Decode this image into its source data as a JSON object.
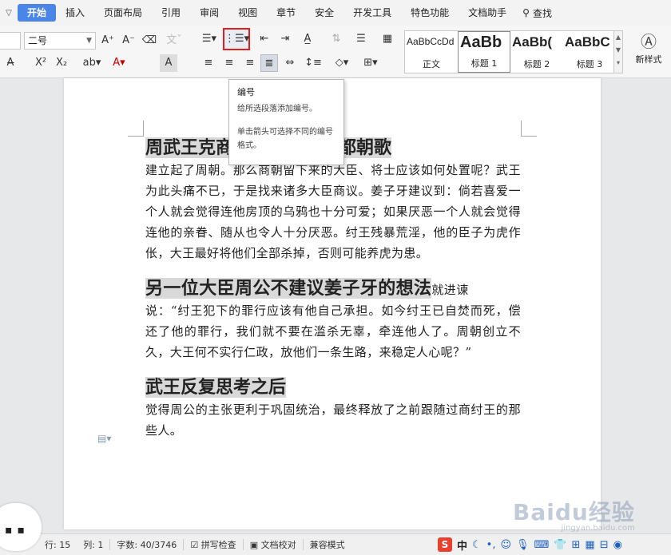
{
  "menu": {
    "tabs": [
      "开始",
      "插入",
      "页面布局",
      "引用",
      "审阅",
      "视图",
      "章节",
      "安全",
      "开发工具",
      "特色功能",
      "文档助手"
    ],
    "active": "开始",
    "search_label": "查找"
  },
  "toolbar": {
    "font_size": "二号",
    "styles": [
      {
        "sample": "AaBbCcDd",
        "name": "正文"
      },
      {
        "sample": "AaBb",
        "name": "标题 1"
      },
      {
        "sample": "AaBb(",
        "name": "标题 2"
      },
      {
        "sample": "AaBbC",
        "name": "标题 3"
      }
    ],
    "new_style_label": "新样式"
  },
  "tooltip": {
    "title": "编号",
    "line1": "给所选段落添加编号。",
    "line2": "单击箭头可选择不同的编号格式。"
  },
  "document": {
    "h1": "周武王克商后，占领了商都朝歌",
    "p1": "建立起了周朝。那么商朝留下来的大臣、将士应该如何处置呢？武王为此头痛不已，于是找来诸多大臣商议。姜子牙建议到：倘若喜爱一个人就会觉得连他房顶的乌鸦也十分可爱；如果厌恶一个人就会觉得连他的亲眷、随从也令人十分厌恶。纣王残暴荒淫，他的臣子为虎作伥，大王最好将他们全部杀掉，否则可能养虎为患。",
    "h2": "另一位大臣周公不建议姜子牙的想法",
    "p2_inline": "就进谏",
    "p2": "说：“纣王犯下的罪行应该有他自己承担。如今纣王已自焚而死，偿还了他的罪行，我们就不要在滥杀无辜，牵连他人了。周朝创立不久，大王何不实行仁政，放他们一条生路，来稳定人心呢？”",
    "h3": "武王反复思考之后",
    "p3": "觉得周公的主张更利于巩固统治，最终释放了之前跟随过商纣王的那些人。"
  },
  "status": {
    "row": "行: 15",
    "col": "列: 1",
    "words": "字数: 40/3746",
    "spell": "拼写检查",
    "proof": "文档校对",
    "compat": "兼容模式"
  },
  "tray": {
    "ime": "S",
    "lang": "中"
  },
  "watermark": {
    "brand": "Baidu经验",
    "url": "jingyan.baidu.com"
  }
}
